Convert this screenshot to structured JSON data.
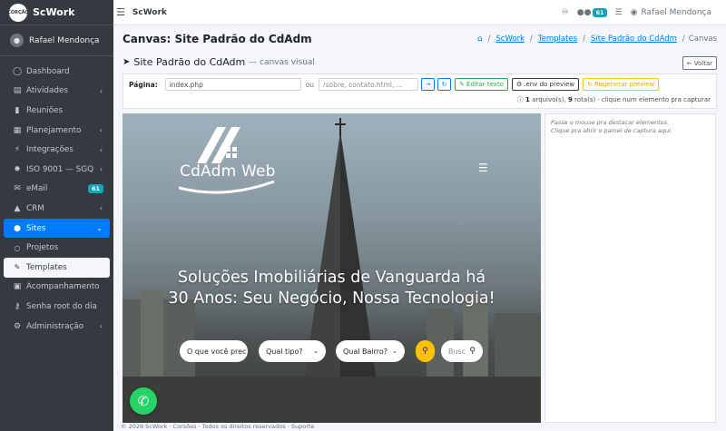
{
  "app": {
    "name": "ScWork",
    "logo_text": "CORÇÃO"
  },
  "sidebar": {
    "user": "Rafael Mendonça",
    "items": [
      {
        "label": "Dashboard",
        "icon": "tachometer-icon"
      },
      {
        "label": "Atividades",
        "icon": "tasks-icon"
      },
      {
        "label": "Reuniões",
        "icon": "video-icon"
      },
      {
        "label": "Planejamento",
        "icon": "calendar-icon"
      },
      {
        "label": "Integrações",
        "icon": "plug-icon"
      },
      {
        "label": "ISO 9001 — SGQ",
        "icon": "certificate-icon"
      },
      {
        "label": "eMail",
        "icon": "envelope-icon",
        "badge": "61"
      },
      {
        "label": "CRM",
        "icon": "bullhorn-icon"
      },
      {
        "label": "Sites",
        "icon": "globe-icon"
      },
      {
        "label": "Projetos",
        "icon": "circle-icon"
      },
      {
        "label": "Templates",
        "icon": "paint-icon"
      },
      {
        "label": "Acompanhamento",
        "icon": "clipboard-icon"
      },
      {
        "label": "Senha root do dia",
        "icon": "key-icon"
      },
      {
        "label": "Administração",
        "icon": "cogs-icon"
      }
    ]
  },
  "topbar": {
    "title": "ScWork",
    "badge": "61",
    "user": "Rafael Mendonça"
  },
  "header": {
    "title": "Canvas: Site Padrão do CdAdm",
    "breadcrumb": [
      "ScWork",
      "Templates",
      "Site Padrão do CdAdm",
      "Canvas"
    ]
  },
  "canvas": {
    "subtitle": "Site Padrão do CdAdm",
    "subtitle_muted": "— canvas visual",
    "back_label": "Voltar",
    "page_label": "Página:",
    "page_value": "index.php",
    "or_label": "ou",
    "path_placeholder": "/sobre, contato.html, ...",
    "edit_label": "Editar texto",
    "env_label": ".env do preview",
    "regen_label": "Regenerar preview",
    "count_files": "1",
    "count_files_text": "arquivo(s),",
    "count_routes": "9",
    "count_routes_text": "rota(s) · clique num elemento pra capturar"
  },
  "preview": {
    "logo": "CdAdm Web",
    "hero_line1": "Soluções Imobiliárias de Vanguarda há",
    "hero_line2": "30 Anos: Seu Negócio, Nossa Tecnologia!",
    "search_placeholder": "O que você prec",
    "type_select": "Qual tipo?",
    "neighborhood_select": "Qual Bairro?",
    "code_placeholder": "Busc"
  },
  "side_panel": {
    "hint_line1": "Passe o mouse pra destacar elementos.",
    "hint_line2": "Clique pra abrir o painel de captura aqui."
  },
  "footer": {
    "text": "© 2026 ScWork · Corsões · Todos os direitos reservados   ·   Suporte"
  }
}
